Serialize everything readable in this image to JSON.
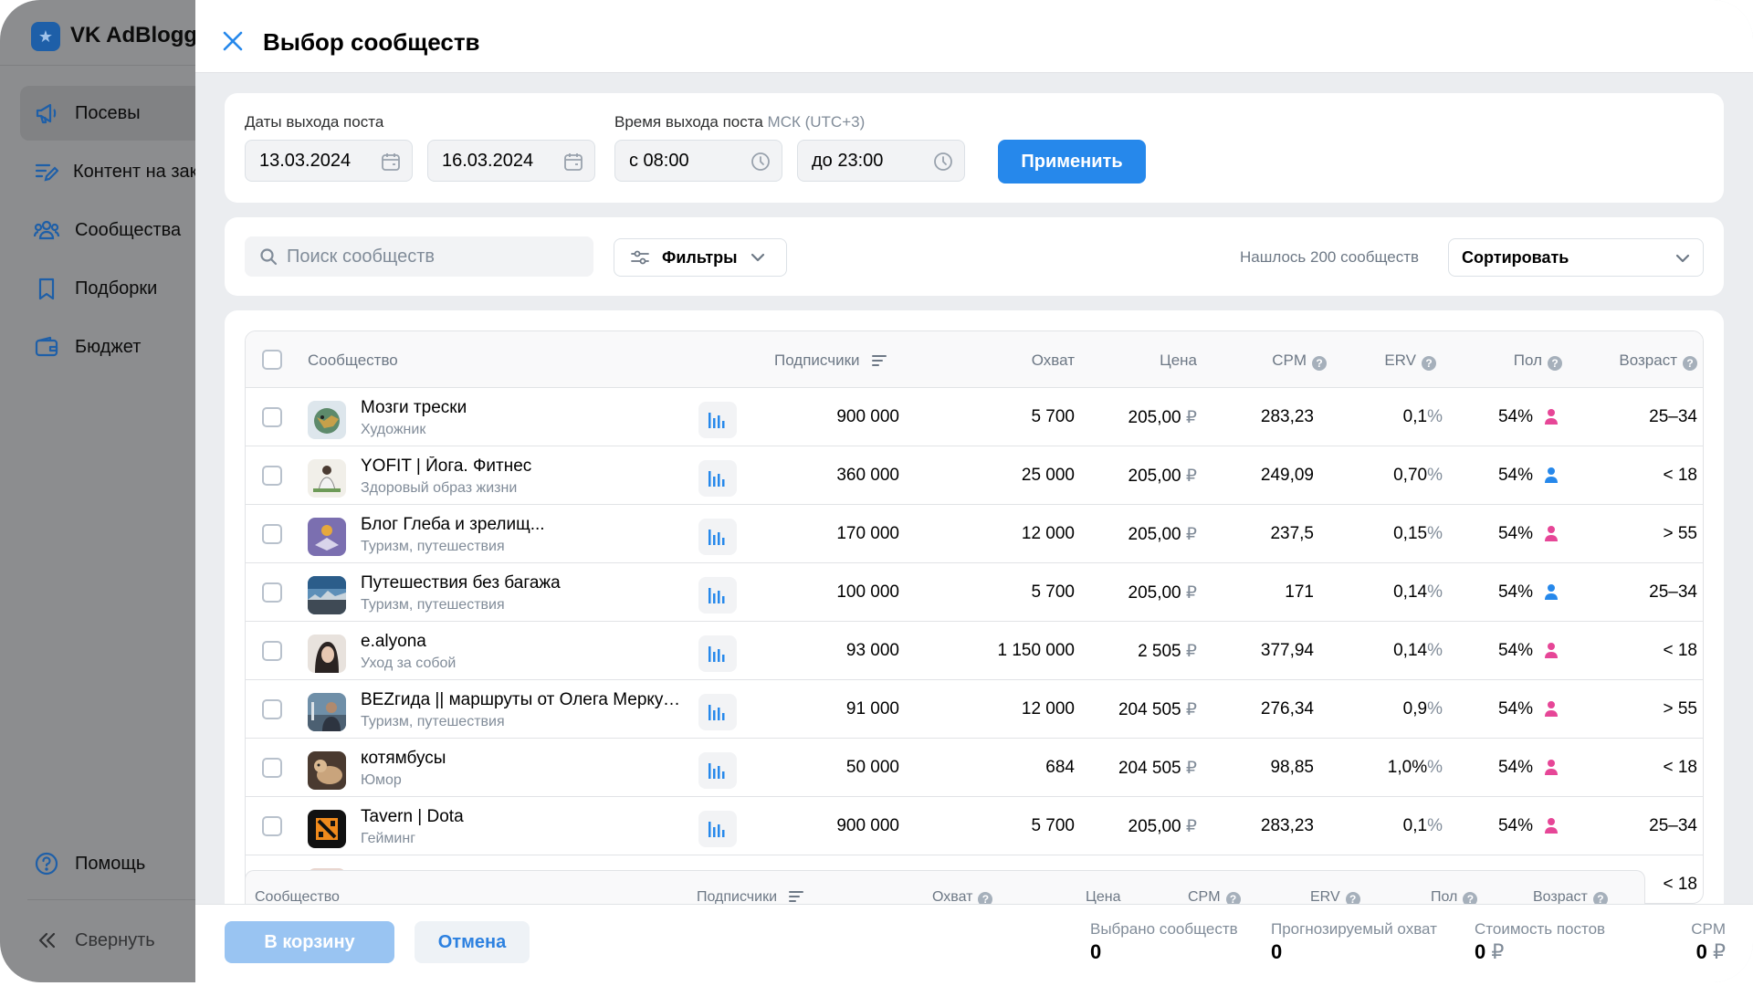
{
  "sidebar": {
    "logo_text": "VK AdBlogger",
    "items": [
      {
        "label": "Посевы",
        "icon": "megaphone-icon",
        "active": true
      },
      {
        "label": "Контент на заказ",
        "icon": "edit-list-icon",
        "active": false
      },
      {
        "label": "Сообщества",
        "icon": "users-icon",
        "active": false
      },
      {
        "label": "Подборки",
        "icon": "bookmark-icon",
        "active": false
      },
      {
        "label": "Бюджет",
        "icon": "wallet-icon",
        "active": false
      }
    ],
    "help_label": "Помощь",
    "collapse_label": "Свернуть"
  },
  "modal": {
    "title": "Выбор сообществ"
  },
  "dates": {
    "label": "Даты выхода поста",
    "from": "13.03.2024",
    "to": "16.03.2024"
  },
  "time": {
    "label": "Время выхода поста",
    "tz": "МСК (UTC+3)",
    "from": "с 08:00",
    "to": "до 23:00"
  },
  "apply_label": "Применить",
  "search": {
    "placeholder": "Поиск сообществ"
  },
  "filters_label": "Фильтры",
  "found_text": "Нашлось 200 сообществ",
  "sort_label": "Сортировать",
  "table": {
    "headers": {
      "community": "Сообщество",
      "subscribers": "Подписчики",
      "reach": "Охват",
      "price": "Цена",
      "cpm": "CPM",
      "erv": "ERV",
      "sex": "Пол",
      "age": "Возраст"
    },
    "currency": "₽",
    "rows": [
      {
        "name": "Мозги трески",
        "category": "Художник",
        "subscribers": "900 000",
        "reach": "5 700",
        "price": "205,00",
        "cpm": "283,23",
        "erv": "0,1",
        "sex_pct": "54",
        "sex": "female",
        "age": "25–34"
      },
      {
        "name": "YOFIT | Йога. Фитнес",
        "category": "Здоровый образ жизни",
        "subscribers": "360 000",
        "reach": "25 000",
        "price": "205,00",
        "cpm": "249,09",
        "erv": "0,70",
        "sex_pct": "54",
        "sex": "male",
        "age": "< 18"
      },
      {
        "name": "Блог Глеба и зрелищ...",
        "category": "Туризм, путешествия",
        "subscribers": "170 000",
        "reach": "12 000",
        "price": "205,00",
        "cpm": "237,5",
        "erv": "0,15",
        "sex_pct": "54",
        "sex": "female",
        "age": "> 55"
      },
      {
        "name": "Путешествия без багажа",
        "category": "Туризм, путешествия",
        "subscribers": "100 000",
        "reach": "5 700",
        "price": "205,00",
        "cpm": "171",
        "erv": "0,14",
        "sex_pct": "54",
        "sex": "male",
        "age": "25–34"
      },
      {
        "name": "e.alyona",
        "category": "Уход за собой",
        "subscribers": "93 000",
        "reach": "1 150 000",
        "price": "2 505",
        "cpm": "377,94",
        "erv": "0,14",
        "sex_pct": "54",
        "sex": "female",
        "age": "< 18"
      },
      {
        "name": "BEZгида || маршруты от Олега Меркулова",
        "category": "Туризм, путешествия",
        "subscribers": "91 000",
        "reach": "12 000",
        "price": "204 505",
        "cpm": "276,34",
        "erv": "0,9",
        "sex_pct": "54",
        "sex": "female",
        "age": "> 55"
      },
      {
        "name": "котямбусы",
        "category": "Юмор",
        "subscribers": "50 000",
        "reach": "684",
        "price": "204 505",
        "cpm": "98,85",
        "erv": "1,0%",
        "sex_pct": "54",
        "sex": "female",
        "age": "< 18"
      },
      {
        "name": "Tavern | Dota",
        "category": "Гейминг",
        "subscribers": "900 000",
        "reach": "5 700",
        "price": "205,00",
        "cpm": "283,23",
        "erv": "0,1",
        "sex_pct": "54",
        "sex": "female",
        "age": "25–34"
      }
    ],
    "partial_age": "< 18"
  },
  "footer": {
    "cart_label": "В корзину",
    "cancel_label": "Отмена",
    "selected_label": "Выбрано сообществ",
    "selected_value": "0",
    "reach_label": "Прогнозируемый охват",
    "reach_value": "0",
    "cost_label": "Стоимость постов",
    "cost_value": "0",
    "cpm_label": "CPM",
    "cpm_value": "0"
  },
  "colors": {
    "accent": "#2688eb",
    "female": "#e64697",
    "male": "#2688eb"
  }
}
